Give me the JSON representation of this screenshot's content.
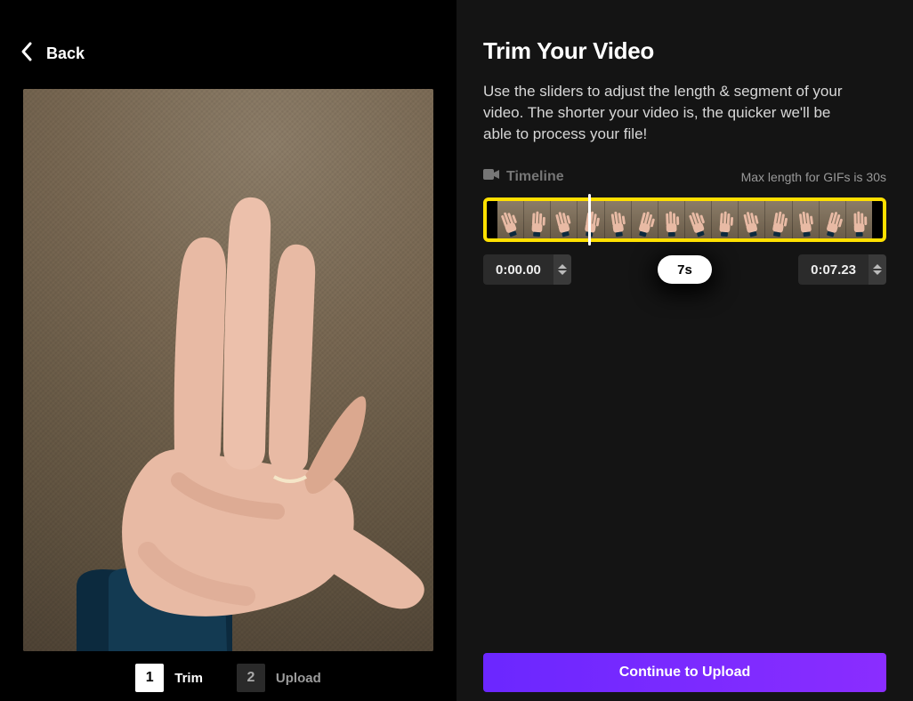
{
  "back": {
    "label": "Back"
  },
  "steps": [
    {
      "num": "1",
      "label": "Trim",
      "active": true
    },
    {
      "num": "2",
      "label": "Upload",
      "active": false
    }
  ],
  "page": {
    "title": "Trim Your Video",
    "description": "Use the sliders to adjust the length & segment of your video. The shorter your video is, the quicker we'll be able to process your file!"
  },
  "timeline": {
    "icon": "video-camera-icon",
    "label": "Timeline",
    "hint": "Max length for GIFs is 30s",
    "frame_count": 14,
    "selection_color": "#ffe000",
    "playhead_percent": 26
  },
  "times": {
    "start": "0:00.00",
    "duration": "7s",
    "end": "0:07.23"
  },
  "cta": {
    "label": "Continue to Upload"
  },
  "preview": {
    "subject": "hand-on-carpet",
    "skin": "#e8baa4",
    "skin_shadow": "#c98f78",
    "watch": "#0c2a3e",
    "carpet": "#6b5c4a"
  }
}
